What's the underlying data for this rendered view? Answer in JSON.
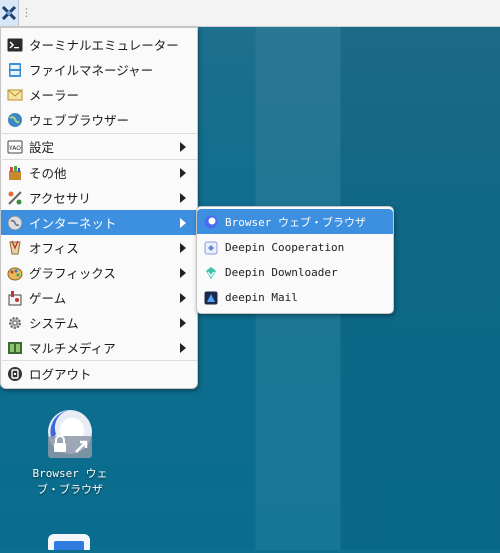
{
  "taskbar": {
    "start_icon": "start-menu-icon",
    "separator": "⋮"
  },
  "menu": {
    "items": [
      {
        "label": "ターミナルエミュレーター",
        "icon": "terminal-icon"
      },
      {
        "label": "ファイルマネージャー",
        "icon": "file-manager-icon"
      },
      {
        "label": "メーラー",
        "icon": "mail-icon"
      },
      {
        "label": "ウェブブラウザー",
        "icon": "web-browser-icon"
      },
      {
        "label": "設定",
        "icon": "settings-icon"
      },
      {
        "label": "その他",
        "icon": "other-icon"
      },
      {
        "label": "アクセサリ",
        "icon": "accessories-icon"
      },
      {
        "label": "インターネット",
        "icon": "internet-icon"
      },
      {
        "label": "オフィス",
        "icon": "office-icon"
      },
      {
        "label": "グラフィックス",
        "icon": "graphics-icon"
      },
      {
        "label": "ゲーム",
        "icon": "games-icon"
      },
      {
        "label": "システム",
        "icon": "system-icon"
      },
      {
        "label": "マルチメディア",
        "icon": "multimedia-icon"
      },
      {
        "label": "ログアウト",
        "icon": "logout-icon"
      }
    ]
  },
  "submenu": {
    "items": [
      {
        "label": "Browser ウェブ・ブラウザ",
        "icon": "browser-icon"
      },
      {
        "label": "Deepin Cooperation",
        "icon": "cooperation-icon"
      },
      {
        "label": "Deepin Downloader",
        "icon": "downloader-icon"
      },
      {
        "label": "deepin Mail",
        "icon": "deepin-mail-icon"
      }
    ]
  },
  "desktop": {
    "icon_label_line1": "Browser ウェ",
    "icon_label_line2": "ブ・ブラウザ"
  },
  "colors": {
    "highlight": "#3d8fe0",
    "desktop": "#0f6f8f"
  }
}
